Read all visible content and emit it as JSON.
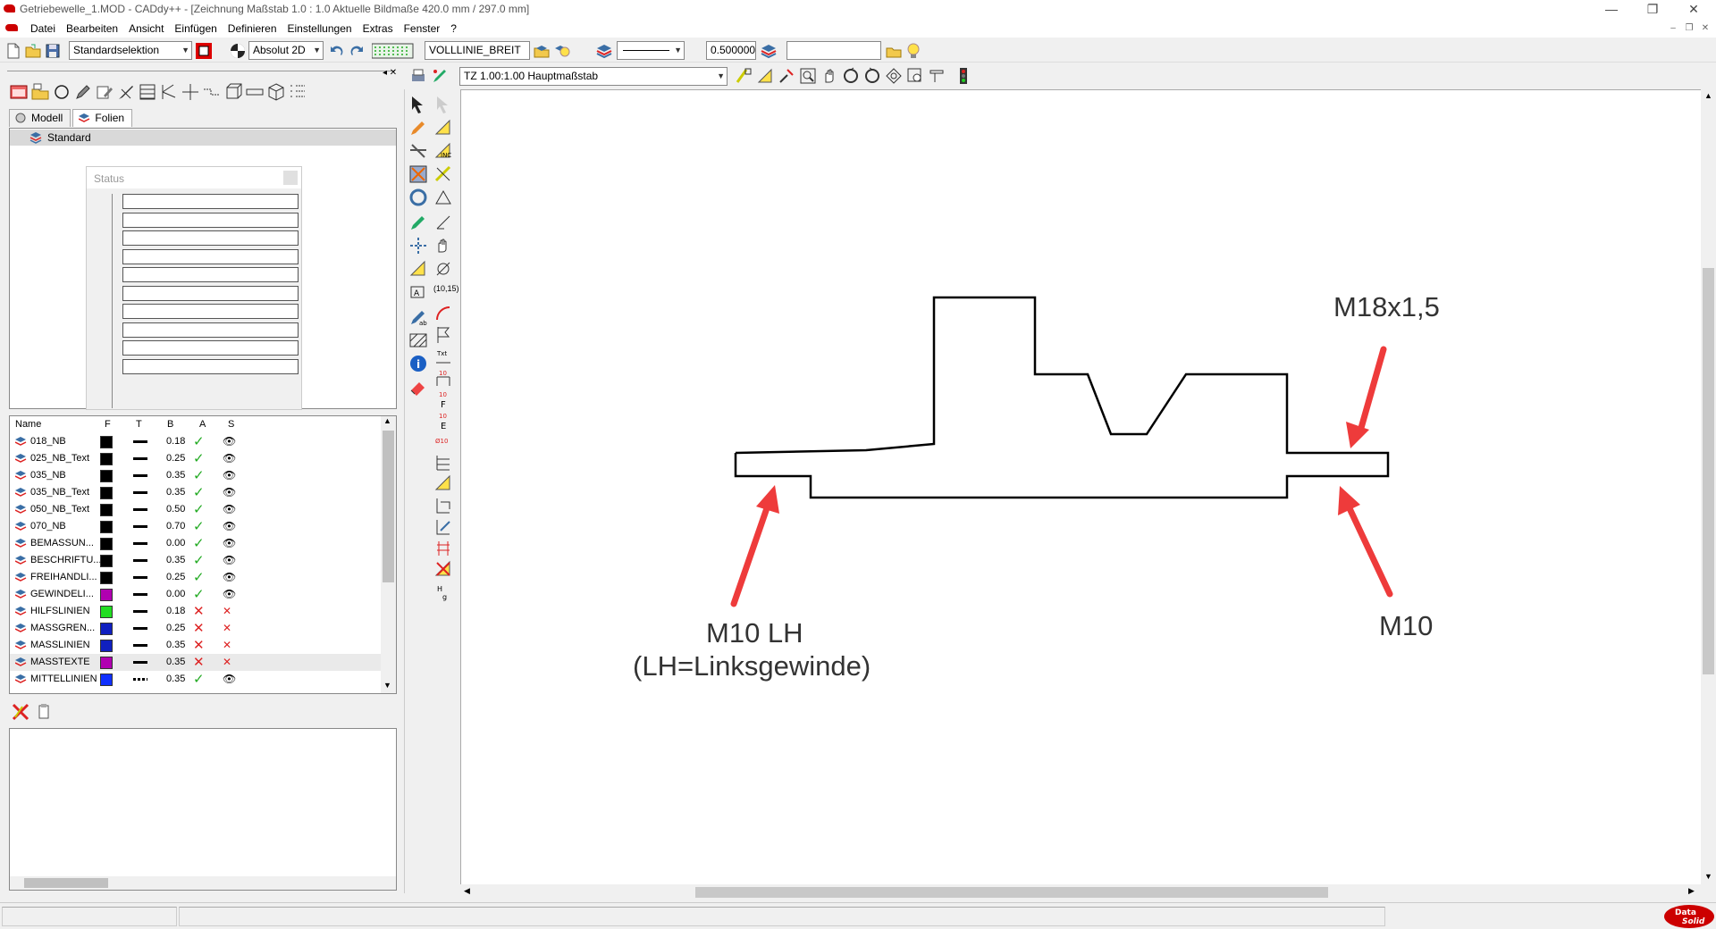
{
  "window": {
    "title": "Getriebewelle_1.MOD  -  CADdy++ - [Zeichnung   Maßstab 1.0 : 1.0   Aktuelle Bildmaße 420.0 mm / 297.0 mm]",
    "minimize": "—",
    "restore": "❐",
    "close": "✕"
  },
  "menu": {
    "items": [
      "Datei",
      "Bearbeiten",
      "Ansicht",
      "Einfügen",
      "Definieren",
      "Einstellungen",
      "Extras",
      "Fenster",
      "?"
    ]
  },
  "toolbar1": {
    "selection_mode": "Standardselektion",
    "coord_mode": "Absolut 2D",
    "line_type": "VOLLLINIE_BREIT",
    "line_width": "0.500000",
    "search_value": ""
  },
  "toolbar2": {
    "view_scale": "TZ 1.00:1.00 Hauptmaßstab"
  },
  "left_panel": {
    "tabs": [
      "Modell",
      "Folien"
    ],
    "tree_item": "Standard",
    "status_window": {
      "title": "Status",
      "rows": 10
    }
  },
  "layer_table": {
    "headers": {
      "name": "Name",
      "f": "F",
      "t": "T",
      "b": "B",
      "a": "A",
      "s": "S"
    },
    "rows": [
      {
        "name": "018_NB",
        "color": "#000000",
        "line": "solid",
        "width": "0.18",
        "a": "✓",
        "s": "👁",
        "a_ok": true,
        "s_ok": true
      },
      {
        "name": "025_NB_Text",
        "color": "#000000",
        "line": "solid",
        "width": "0.25",
        "a": "✓",
        "s": "👁",
        "a_ok": true,
        "s_ok": true
      },
      {
        "name": "035_NB",
        "color": "#000000",
        "line": "solid",
        "width": "0.35",
        "a": "✓",
        "s": "👁",
        "a_ok": true,
        "s_ok": true
      },
      {
        "name": "035_NB_Text",
        "color": "#000000",
        "line": "solid",
        "width": "0.35",
        "a": "✓",
        "s": "👁",
        "a_ok": true,
        "s_ok": true
      },
      {
        "name": "050_NB_Text",
        "color": "#000000",
        "line": "solid",
        "width": "0.50",
        "a": "✓",
        "s": "👁",
        "a_ok": true,
        "s_ok": true
      },
      {
        "name": "070_NB",
        "color": "#000000",
        "line": "solid",
        "width": "0.70",
        "a": "✓",
        "s": "👁",
        "a_ok": true,
        "s_ok": true
      },
      {
        "name": "BEMASSUN...",
        "color": "#000000",
        "line": "solid",
        "width": "0.00",
        "a": "✓",
        "s": "👁",
        "a_ok": true,
        "s_ok": true
      },
      {
        "name": "BESCHRIFTU...",
        "color": "#000000",
        "line": "solid",
        "width": "0.35",
        "a": "✓",
        "s": "👁",
        "a_ok": true,
        "s_ok": true
      },
      {
        "name": "FREIHANDLI...",
        "color": "#000000",
        "line": "solid",
        "width": "0.25",
        "a": "✓",
        "s": "👁",
        "a_ok": true,
        "s_ok": true
      },
      {
        "name": "GEWINDELI...",
        "color": "#b000b0",
        "line": "solid",
        "width": "0.00",
        "a": "✓",
        "s": "👁",
        "a_ok": true,
        "s_ok": true
      },
      {
        "name": "HILFSLINIEN",
        "color": "#22dd22",
        "line": "solid",
        "width": "0.18",
        "a": "✕",
        "s": "✕",
        "a_ok": false,
        "s_ok": false
      },
      {
        "name": "MASSGREN...",
        "color": "#1020c0",
        "line": "solid",
        "width": "0.25",
        "a": "✕",
        "s": "✕",
        "a_ok": false,
        "s_ok": false
      },
      {
        "name": "MASSLINIEN",
        "color": "#1020c0",
        "line": "solid",
        "width": "0.35",
        "a": "✕",
        "s": "✕",
        "a_ok": false,
        "s_ok": false
      },
      {
        "name": "MASSTEXTE",
        "color": "#b000b0",
        "line": "solid",
        "width": "0.35",
        "a": "✕",
        "s": "✕",
        "a_ok": false,
        "s_ok": false
      },
      {
        "name": "MITTELLINIEN",
        "color": "#1030ff",
        "line": "dash",
        "width": "0.35",
        "a": "✓",
        "s": "👁",
        "a_ok": true,
        "s_ok": true
      }
    ]
  },
  "drawing": {
    "annotations": {
      "m18": "M18x1,5",
      "m10lh": "M10 LH",
      "lh_note": "(LH=Linksgewinde)",
      "m10": "M10"
    },
    "line_color": "#000000",
    "arrow_color": "#ee3b3b"
  },
  "brand": {
    "line1": "Data",
    "line2": "Solid"
  }
}
